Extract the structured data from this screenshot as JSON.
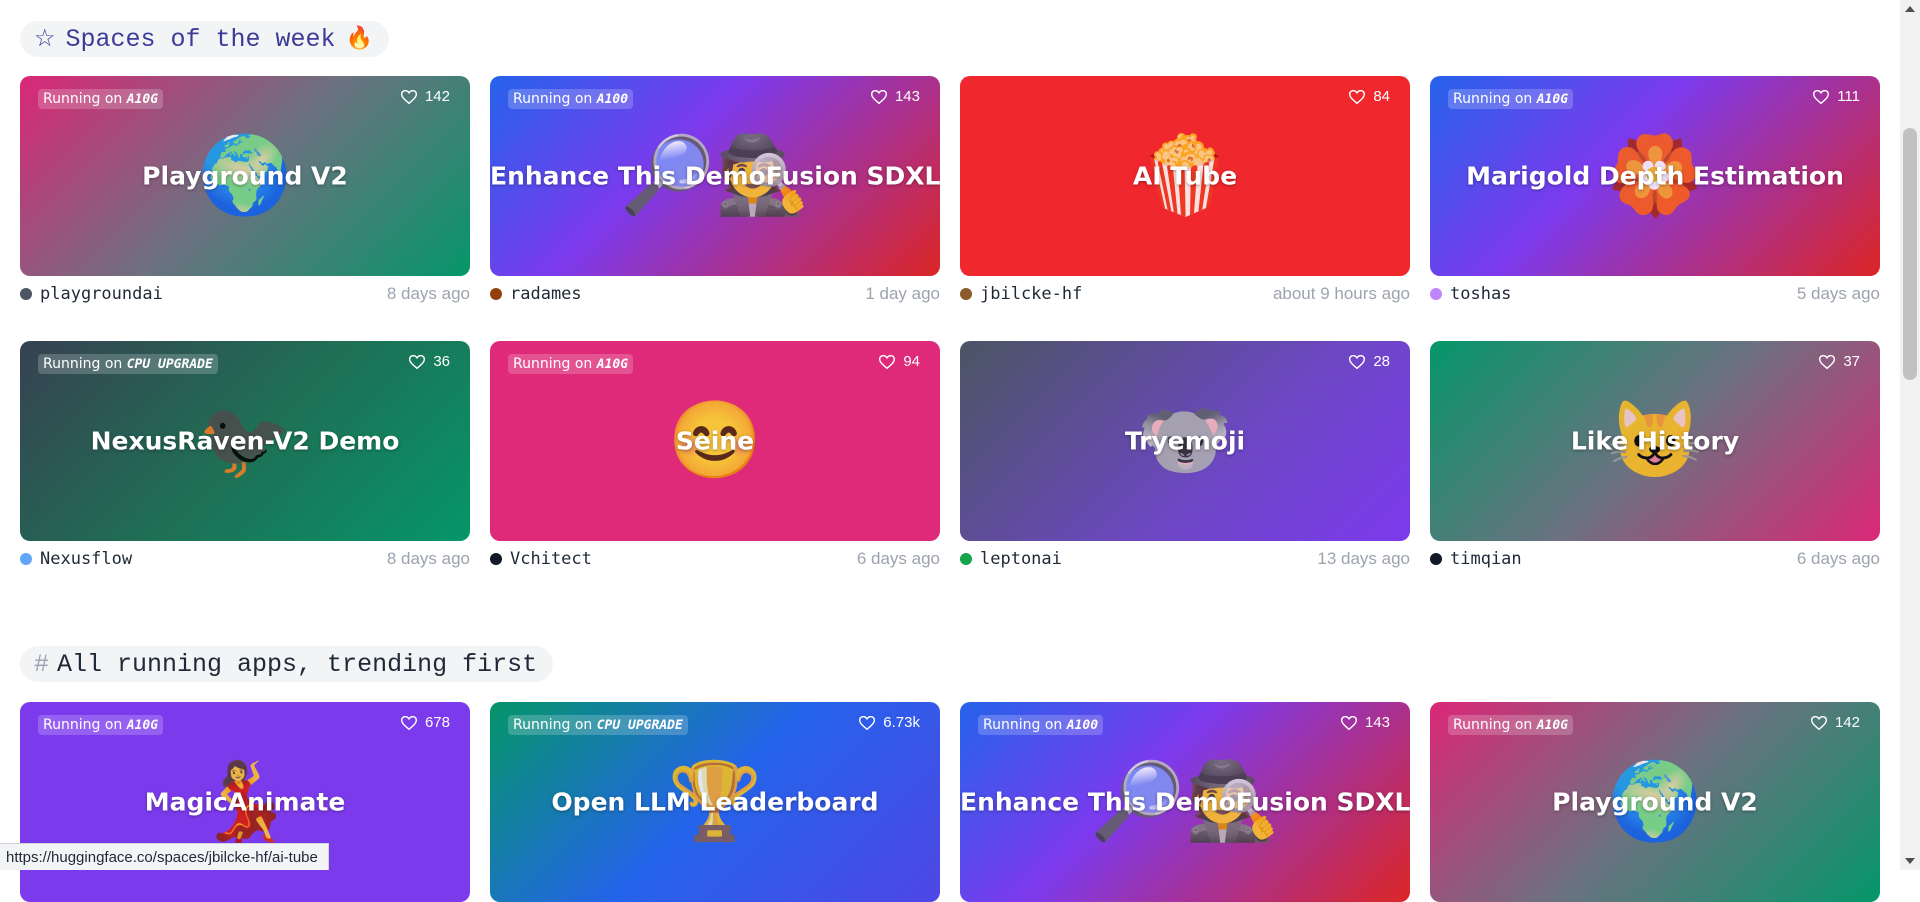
{
  "spaces_of_week": {
    "star_icon": "star-icon",
    "title": "Spaces of the week",
    "fire": "🔥",
    "cards": [
      {
        "title": "Playground V2",
        "emoji": "🌍",
        "badge_prefix": "Running on",
        "hardware": "A10G",
        "likes": "142",
        "author": "playgroundai",
        "time": "8 days ago",
        "bg": "linear-gradient(135deg,#db2777 0%,#6b7280 50%,#059669 100%)",
        "avatar": "#4b5563"
      },
      {
        "title": "Enhance This DemoFusion SDXL",
        "emoji": "🔎🕵️",
        "badge_prefix": "Running on",
        "hardware": "A100",
        "likes": "143",
        "author": "radames",
        "time": "1 day ago",
        "bg": "linear-gradient(135deg,#2563eb 0%,#7c3aed 40%,#dc2626 100%)",
        "avatar": "#92400e"
      },
      {
        "title": "AI Tube",
        "emoji": "🍿",
        "badge_prefix": "",
        "hardware": "",
        "likes": "84",
        "author": "jbilcke-hf",
        "time": "about 9 hours ago",
        "bg": "#f0282e",
        "avatar": "#8b5a2b"
      },
      {
        "title": "Marigold Depth Estimation",
        "emoji": "🏵️",
        "badge_prefix": "Running on",
        "hardware": "A10G",
        "likes": "111",
        "author": "toshas",
        "time": "5 days ago",
        "bg": "linear-gradient(135deg,#2563eb 0%,#7c3aed 40%,#dc2626 100%)",
        "avatar": "#c084fc"
      },
      {
        "title": "NexusRaven-V2 Demo",
        "emoji": "🐦‍⬛",
        "badge_prefix": "Running on",
        "hardware": "CPU UPGRADE",
        "likes": "36",
        "author": "Nexusflow",
        "time": "8 days ago",
        "bg": "linear-gradient(135deg,#374151 0%,#1f6f55 50%,#059669 100%)",
        "avatar": "#60a5fa",
        "pre": "🐦‍⬛ "
      },
      {
        "title": "Seine",
        "emoji": "😊",
        "badge_prefix": "Running on",
        "hardware": "A10G",
        "likes": "94",
        "author": "Vchitect",
        "time": "6 days ago",
        "bg": "#de2a78",
        "avatar": "#111827"
      },
      {
        "title": "Tryemoji",
        "emoji": "🐨",
        "badge_prefix": "",
        "hardware": "",
        "likes": "28",
        "author": "leptonai",
        "time": "13 days ago",
        "bg": "linear-gradient(135deg,#4b5563 0%,#6d47c4 60%,#7c3aed 100%)",
        "avatar": "#16a34a"
      },
      {
        "title": "Like History",
        "emoji": "😺",
        "badge_prefix": "",
        "hardware": "",
        "likes": "37",
        "author": "timqian",
        "time": "6 days ago",
        "bg": "linear-gradient(135deg,#059669 0%,#6b7280 50%,#db2777 100%)",
        "avatar": "#111827"
      }
    ]
  },
  "all_running": {
    "hash": "#",
    "title": "All running apps, trending first",
    "cards": [
      {
        "title": "MagicAnimate",
        "emoji": "💃",
        "badge_prefix": "Running on",
        "hardware": "A10G",
        "likes": "678",
        "bg": "#7c3aed"
      },
      {
        "title": "Open LLM Leaderboard",
        "emoji": "🏆",
        "badge_prefix": "Running on",
        "hardware": "CPU UPGRADE",
        "likes": "6.73k",
        "bg": "linear-gradient(135deg,#059669 0%,#2563eb 50%,#4f46e5 100%)"
      },
      {
        "title": "Enhance This DemoFusion SDXL",
        "emoji": "🔎🕵️",
        "badge_prefix": "Running on",
        "hardware": "A100",
        "likes": "143",
        "bg": "linear-gradient(135deg,#2563eb 0%,#7c3aed 40%,#dc2626 100%)"
      },
      {
        "title": "Playground V2",
        "emoji": "🌍",
        "badge_prefix": "Running on",
        "hardware": "A10G",
        "likes": "142",
        "bg": "linear-gradient(135deg,#db2777 0%,#6b7280 50%,#059669 100%)"
      }
    ]
  },
  "status_url": "https://huggingface.co/spaces/jbilcke-hf/ai-tube"
}
